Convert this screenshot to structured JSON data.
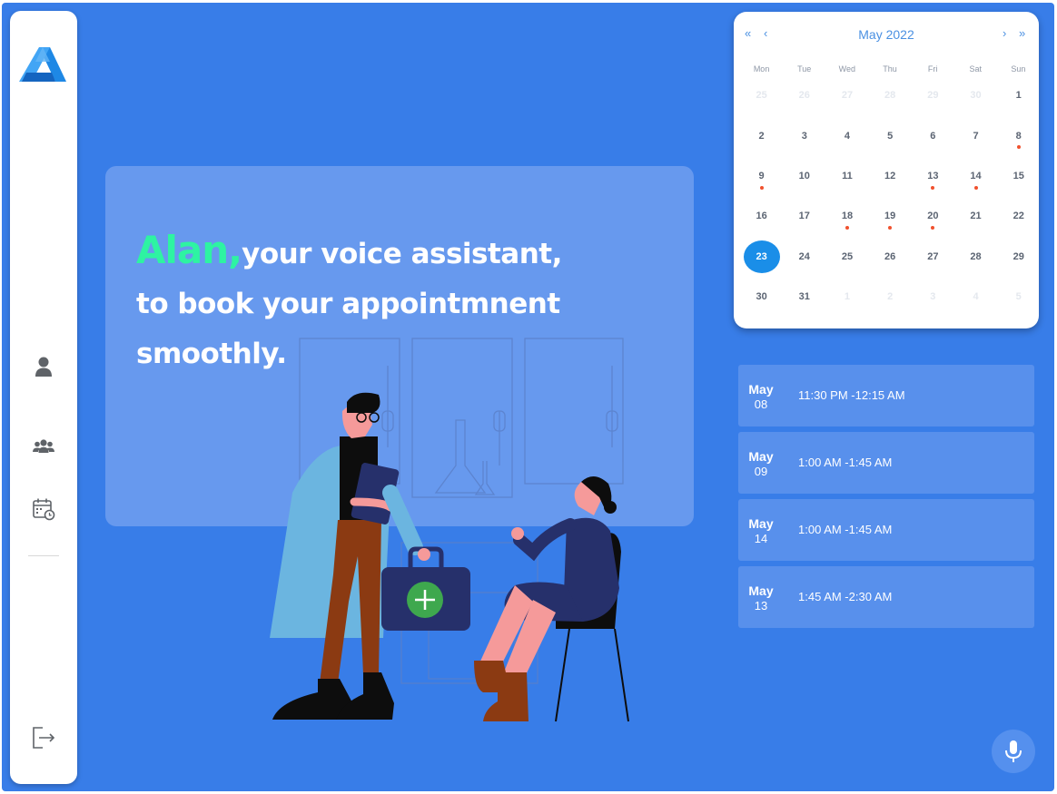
{
  "sidebar": {
    "logo": "alan-logo",
    "items": [
      {
        "name": "profile",
        "icon": "user-icon"
      },
      {
        "name": "team",
        "icon": "users-icon"
      },
      {
        "name": "schedule",
        "icon": "calendar-clock-icon"
      }
    ],
    "logout_icon": "logout-icon"
  },
  "hero": {
    "brand": "Alan,",
    "line1": "your voice assistant,",
    "line2": "to book your appointmnent",
    "line3": "smoothly."
  },
  "calendar": {
    "title": "May 2022",
    "nav_prev_year": "«",
    "nav_prev_month": "‹",
    "nav_next_month": "›",
    "nav_next_year": "»",
    "weekdays": [
      "Mon",
      "Tue",
      "Wed",
      "Thu",
      "Fri",
      "Sat",
      "Sun"
    ],
    "days": [
      {
        "d": "25",
        "muted": true
      },
      {
        "d": "26",
        "muted": true
      },
      {
        "d": "27",
        "muted": true
      },
      {
        "d": "28",
        "muted": true
      },
      {
        "d": "29",
        "muted": true
      },
      {
        "d": "30",
        "muted": true
      },
      {
        "d": "1"
      },
      {
        "d": "2"
      },
      {
        "d": "3"
      },
      {
        "d": "4"
      },
      {
        "d": "5"
      },
      {
        "d": "6"
      },
      {
        "d": "7"
      },
      {
        "d": "8",
        "event": true
      },
      {
        "d": "9",
        "event": true
      },
      {
        "d": "10"
      },
      {
        "d": "11"
      },
      {
        "d": "12"
      },
      {
        "d": "13",
        "event": true
      },
      {
        "d": "14",
        "event": true
      },
      {
        "d": "15"
      },
      {
        "d": "16"
      },
      {
        "d": "17"
      },
      {
        "d": "18",
        "event": true
      },
      {
        "d": "19",
        "event": true
      },
      {
        "d": "20",
        "event": true
      },
      {
        "d": "21"
      },
      {
        "d": "22"
      },
      {
        "d": "23",
        "selected": true
      },
      {
        "d": "24"
      },
      {
        "d": "25"
      },
      {
        "d": "26"
      },
      {
        "d": "27"
      },
      {
        "d": "28"
      },
      {
        "d": "29"
      },
      {
        "d": "30"
      },
      {
        "d": "31"
      },
      {
        "d": "1",
        "muted": true
      },
      {
        "d": "2",
        "muted": true
      },
      {
        "d": "3",
        "muted": true
      },
      {
        "d": "4",
        "muted": true
      },
      {
        "d": "5",
        "muted": true
      }
    ],
    "colors": {
      "accent": "#1a8ee8",
      "event_dot": "#f0512e"
    }
  },
  "appointments": [
    {
      "month": "May",
      "day": "08",
      "time": "11:30 PM -12:15 AM"
    },
    {
      "month": "May",
      "day": "09",
      "time": "1:00 AM -1:45 AM"
    },
    {
      "month": "May",
      "day": "14",
      "time": "1:00 AM -1:45 AM"
    },
    {
      "month": "May",
      "day": "13",
      "time": "1:45 AM -2:30 AM"
    }
  ],
  "mic": {
    "icon": "microphone-icon"
  },
  "colors": {
    "background": "#387de8",
    "brand": "#2ef3a2",
    "card": "#6799ee"
  }
}
